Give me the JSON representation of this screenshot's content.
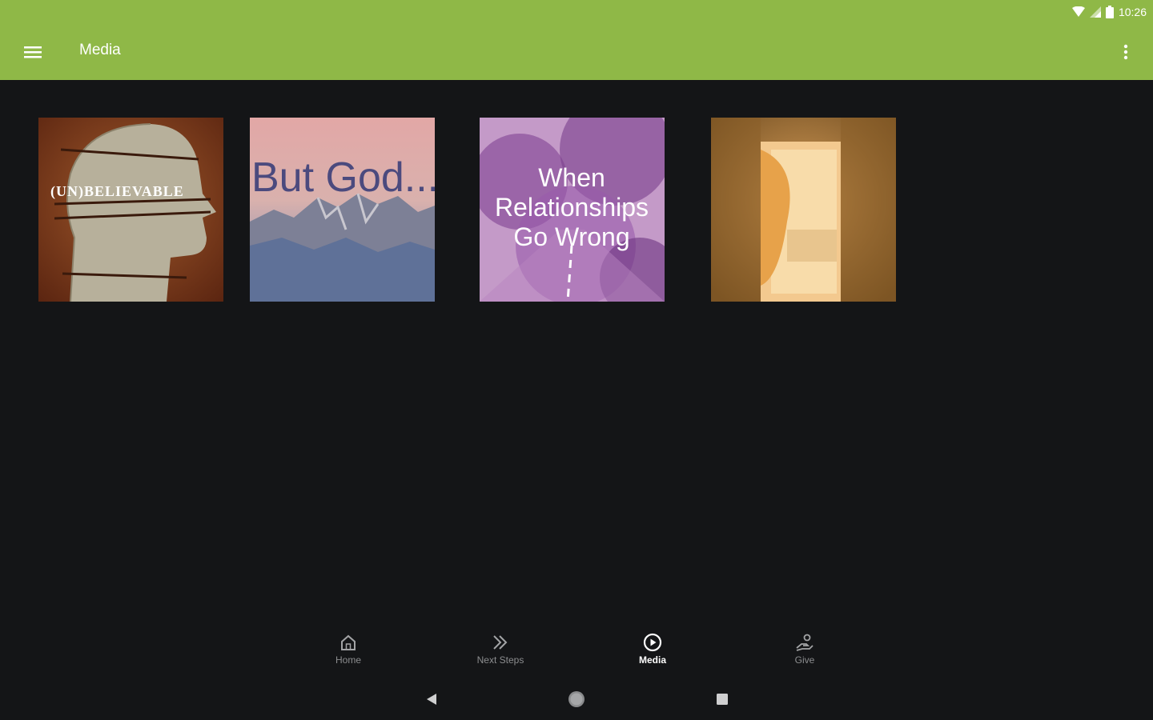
{
  "status_bar": {
    "time": "10:26",
    "icons": [
      "wifi-icon",
      "signal-icon",
      "battery-icon"
    ]
  },
  "app_bar": {
    "title": "Media",
    "background_color": "#8fb847"
  },
  "media_items": [
    {
      "title": "(UN)BELIEVABLE"
    },
    {
      "title": "But God..."
    },
    {
      "title_line1": "When",
      "title_line2": "Relationships",
      "title_line3": "Go Wrong"
    },
    {
      "title": ""
    }
  ],
  "bottom_nav": {
    "items": [
      {
        "label": "Home",
        "icon": "home-icon"
      },
      {
        "label": "Next Steps",
        "icon": "double-chevron-icon"
      },
      {
        "label": "Media",
        "icon": "play-circle-icon",
        "active": true
      },
      {
        "label": "Give",
        "icon": "give-hand-icon"
      }
    ]
  },
  "system_nav": [
    "back-icon",
    "home-circle-icon",
    "recents-icon"
  ]
}
